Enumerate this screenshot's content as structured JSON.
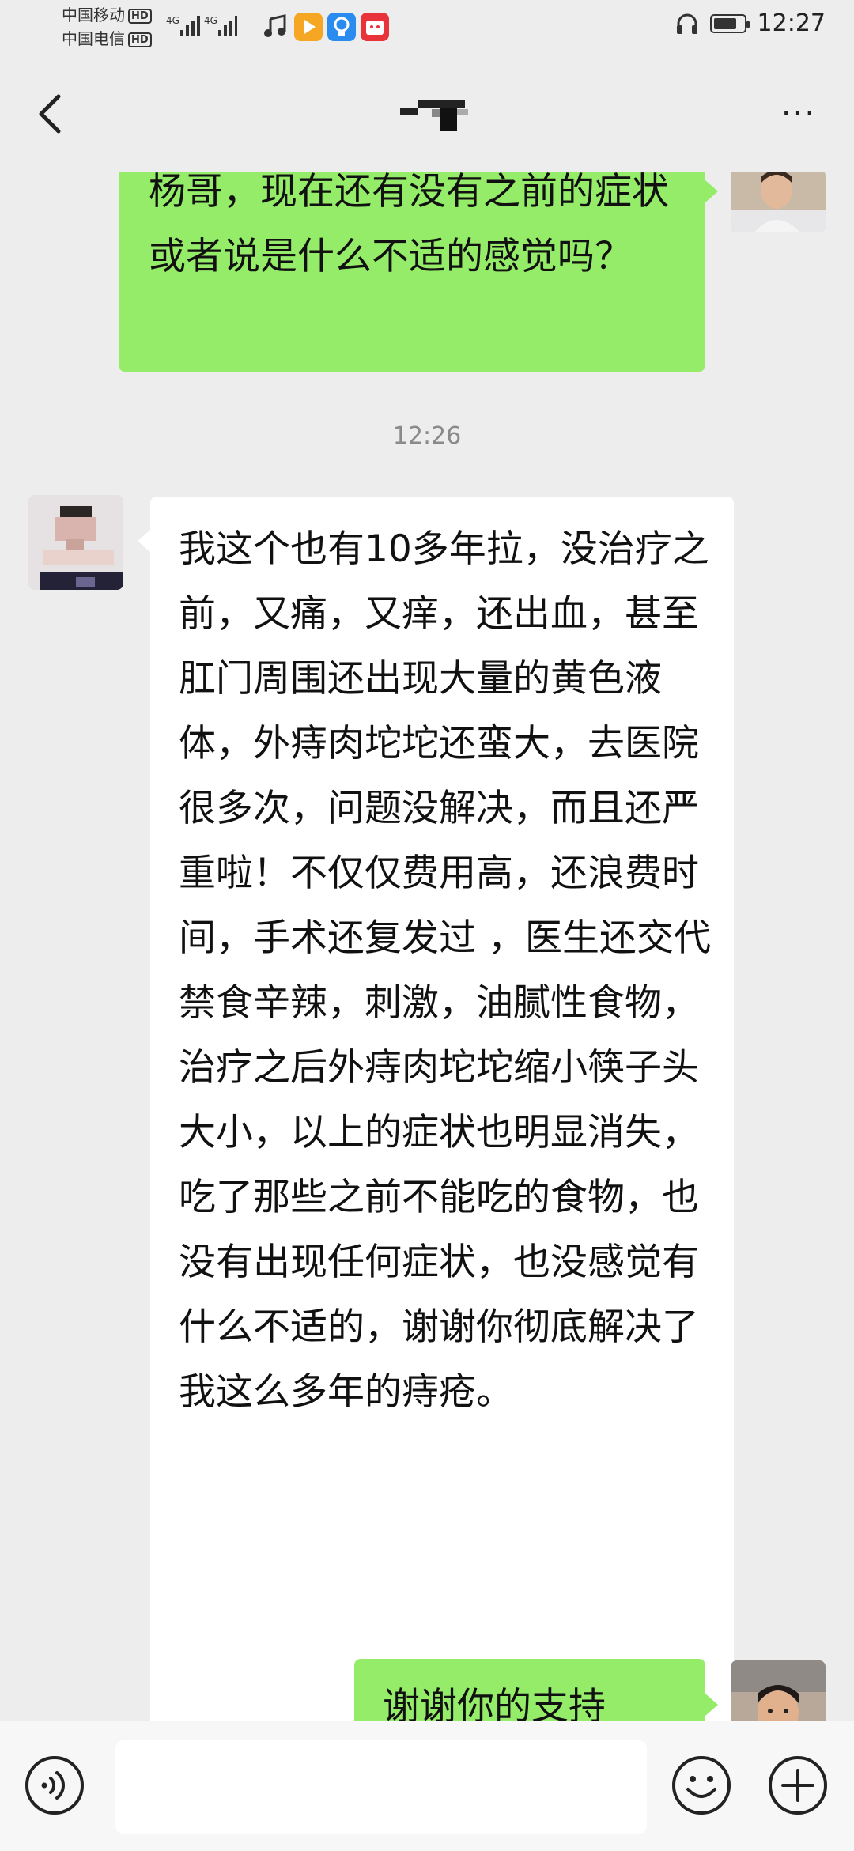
{
  "status_bar": {
    "carrier_1": "中国移动",
    "carrier_2": "中国电信",
    "hd": "HD",
    "net_1": "4G",
    "net_2": "4G",
    "time": "12:27",
    "battery_level": 0.68,
    "icons": [
      "music-icon",
      "video-app-icon",
      "bulb-app-icon",
      "shop-app-icon",
      "headphone-icon",
      "battery-icon"
    ]
  },
  "title_bar": {
    "title": "",
    "more": "···"
  },
  "messages": {
    "m1": {
      "sender": "self",
      "text": "杨哥，现在还有没有之前的症状或者说是什么不适的感觉吗？"
    },
    "timestamp": "12:26",
    "m2": {
      "sender": "other",
      "text": "我这个也有10多年拉，没治疗之前，又痛，又痒，还出血，甚至肛门周围还出现大量的黄色液体，外痔肉坨坨还蛮大，去医院很多次，问题没解决，而且还严重啦！不仅仅费用高，还浪费时间，手术还复发过 ，医生还交代禁食辛辣，刺激，油腻性食物，治疗之后外痔肉坨坨缩小筷子头大小，以上的症状也明显消失，吃了那些之前不能吃的食物，也没有出现任何症状，也没感觉有什么不适的，谢谢你彻底解决了我这么多年的痔疮。"
    },
    "m3": {
      "sender": "self",
      "text": "谢谢你的支持"
    }
  },
  "input_bar": {
    "placeholder": "",
    "icons": [
      "voice-icon",
      "emoji-icon",
      "plus-icon"
    ]
  },
  "colors": {
    "background": "#ededed",
    "self_bubble": "#95ec69",
    "other_bubble": "#ffffff"
  }
}
